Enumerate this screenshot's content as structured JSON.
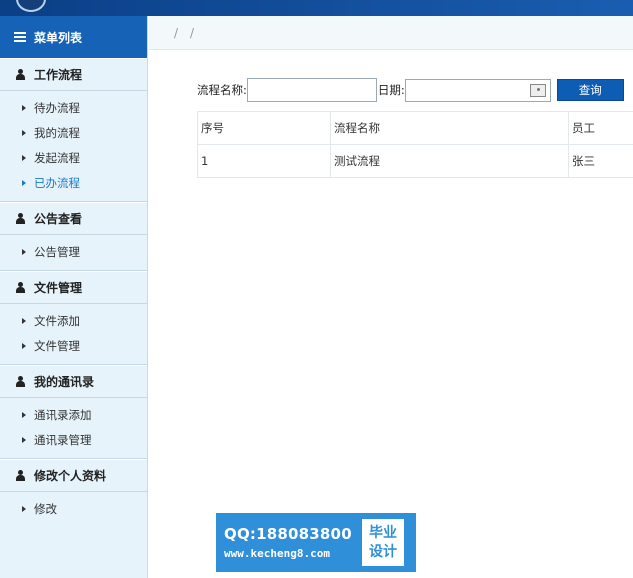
{
  "sidebar": {
    "menu_title": "菜单列表",
    "groups": [
      {
        "title": "工作流程",
        "items": [
          "待办流程",
          "我的流程",
          "发起流程",
          "已办流程"
        ]
      },
      {
        "title": "公告查看",
        "items": [
          "公告管理"
        ]
      },
      {
        "title": "文件管理",
        "items": [
          "文件添加",
          "文件管理"
        ]
      },
      {
        "title": "我的通讯录",
        "items": [
          "通讯录添加",
          "通讯录管理"
        ]
      },
      {
        "title": "修改个人资料",
        "items": [
          "修改"
        ]
      }
    ],
    "active_item": "已办流程"
  },
  "breadcrumb": [
    "/",
    "/"
  ],
  "search": {
    "name_label": "流程名称:",
    "name_value": "",
    "date_label": "日期:",
    "date_value": "",
    "query_button": "查询"
  },
  "table": {
    "headers": [
      "序号",
      "流程名称",
      "员工"
    ],
    "rows": [
      [
        "1",
        "测试流程",
        "张三"
      ]
    ]
  },
  "watermark": {
    "qq": "QQ:188083800",
    "url": "www.kecheng8.com",
    "tag_line1": "毕业",
    "tag_line2": "设计"
  },
  "colors": {
    "header": "#1a5db0",
    "sidebar_bg": "#e6f3fa",
    "menu_title_bg": "#1662b6",
    "active_item": "#1b78c8",
    "query_button": "#0e5db5",
    "watermark": "#2f8fd9"
  },
  "icons": {
    "menu_title": "list-icon",
    "group": "user-icon",
    "item": "caret-right-icon",
    "date_input": "calendar-icon"
  }
}
